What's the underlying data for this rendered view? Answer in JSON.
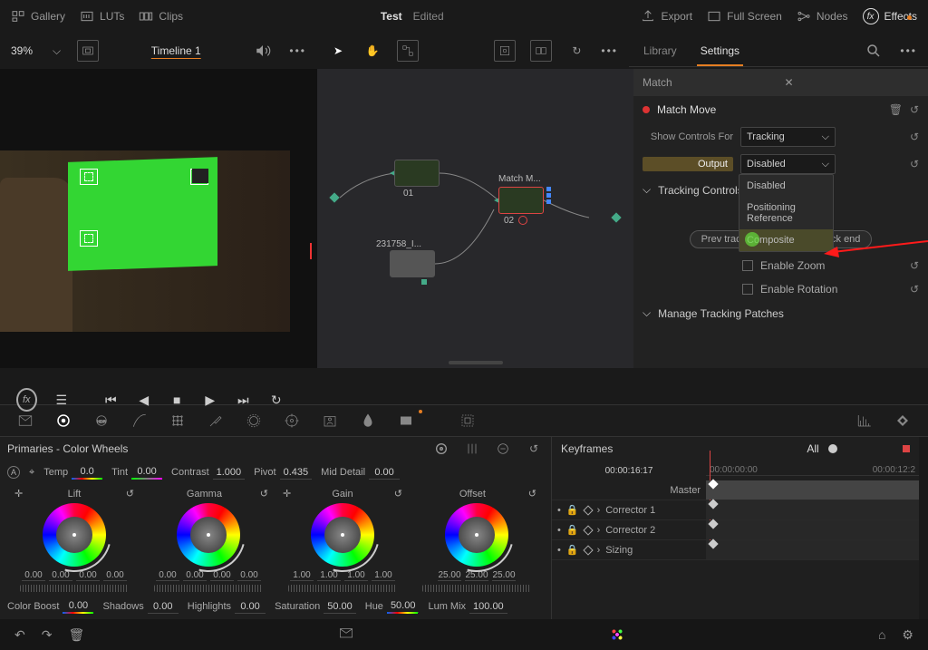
{
  "top": {
    "gallery": "Gallery",
    "luts": "LUTs",
    "clips": "Clips",
    "project": "Test",
    "status": "Edited",
    "export": "Export",
    "fullscreen": "Full Screen",
    "nodes": "Nodes",
    "effects": "Effects"
  },
  "row2": {
    "zoom": "39%",
    "timeline": "Timeline 1",
    "tabs": {
      "library": "Library",
      "settings": "Settings"
    }
  },
  "inspector": {
    "search": "Match",
    "section": "Match Move",
    "showControlsLabel": "Show Controls For",
    "showControlsValue": "Tracking",
    "outputLabel": "Output",
    "outputValue": "Disabled",
    "dropdown": [
      "Disabled",
      "Positioning Reference",
      "Composite"
    ],
    "trackingControls": "Tracking Controls",
    "prevTrack": "Prev track end",
    "nextTrack": "Next track end",
    "enableZoom": "Enable Zoom",
    "enableRotation": "Enable Rotation",
    "managePatches": "Manage Tracking Patches"
  },
  "nodes": {
    "n1": "01",
    "n2": "02",
    "n2label": "Match M...",
    "n3label": "231758_I..."
  },
  "primaries": {
    "title": "Primaries - Color Wheels",
    "temp": {
      "label": "Temp",
      "val": "0.0"
    },
    "tint": {
      "label": "Tint",
      "val": "0.00"
    },
    "contrast": {
      "label": "Contrast",
      "val": "1.000"
    },
    "pivot": {
      "label": "Pivot",
      "val": "0.435"
    },
    "midDetail": {
      "label": "Mid Detail",
      "val": "0.00"
    },
    "wheels": {
      "lift": {
        "name": "Lift",
        "vals": [
          "0.00",
          "0.00",
          "0.00",
          "0.00"
        ]
      },
      "gamma": {
        "name": "Gamma",
        "vals": [
          "0.00",
          "0.00",
          "0.00",
          "0.00"
        ]
      },
      "gain": {
        "name": "Gain",
        "vals": [
          "1.00",
          "1.00",
          "1.00",
          "1.00"
        ]
      },
      "offset": {
        "name": "Offset",
        "vals": [
          "25.00",
          "25.00",
          "25.00"
        ]
      }
    },
    "row2": {
      "colorBoost": {
        "label": "Color Boost",
        "val": "0.00"
      },
      "shadows": {
        "label": "Shadows",
        "val": "0.00"
      },
      "highlights": {
        "label": "Highlights",
        "val": "0.00"
      },
      "saturation": {
        "label": "Saturation",
        "val": "50.00"
      },
      "hue": {
        "label": "Hue",
        "val": "50.00"
      },
      "lumMix": {
        "label": "Lum Mix",
        "val": "100.00"
      }
    }
  },
  "keyframes": {
    "title": "Keyframes",
    "all": "All",
    "tc": "00:00:16:17",
    "ruler": [
      "00:00:00:00",
      "00:00:12:2"
    ],
    "rows": [
      "Master",
      "Corrector 1",
      "Corrector 2",
      "Sizing"
    ]
  }
}
